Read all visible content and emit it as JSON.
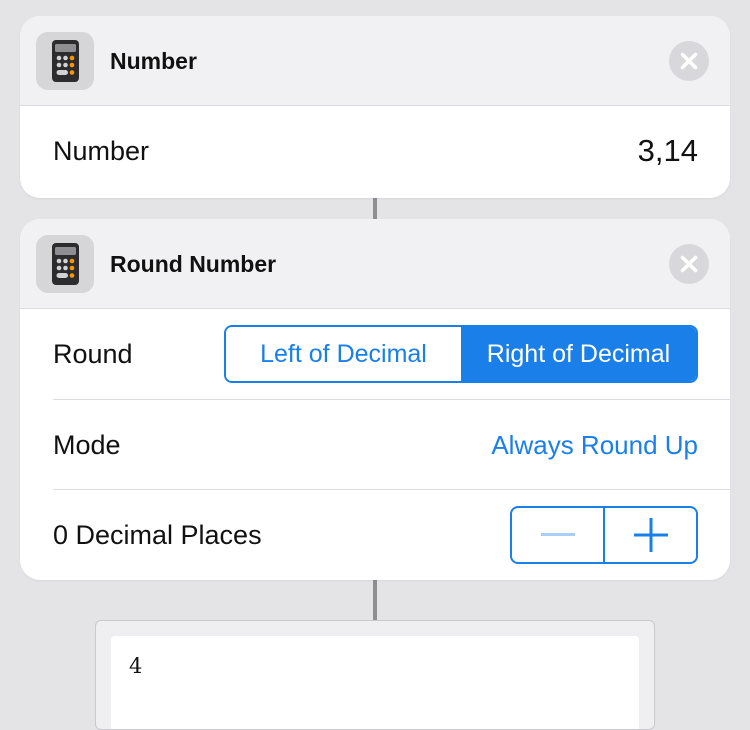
{
  "colors": {
    "accent": "#1a7fe8",
    "background": "#e4e4e7",
    "card": "#ffffff",
    "header": "#f1f1f3"
  },
  "number_action": {
    "title": "Number",
    "icon": "calculator-icon",
    "close_icon": "close-icon",
    "field_label": "Number",
    "field_value": "3,14"
  },
  "round_action": {
    "title": "Round Number",
    "icon": "calculator-icon",
    "close_icon": "close-icon",
    "round_label": "Round",
    "round_options": [
      "Left of Decimal",
      "Right of Decimal"
    ],
    "round_selected": "Right of Decimal",
    "mode_label": "Mode",
    "mode_value": "Always Round Up",
    "decimal_places_label": "0 Decimal Places",
    "stepper_decrement_icon": "minus-icon",
    "stepper_increment_icon": "plus-icon",
    "stepper_decrement_enabled": false
  },
  "result": {
    "value": "4"
  }
}
